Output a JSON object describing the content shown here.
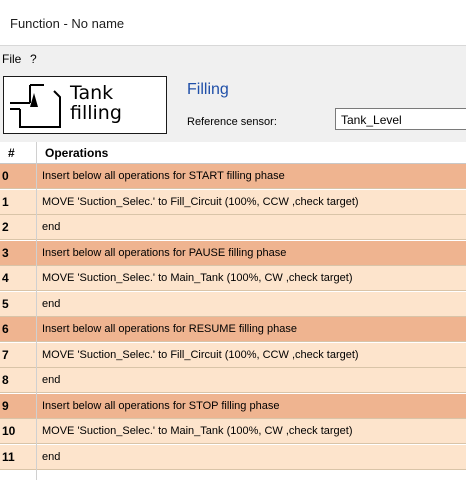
{
  "window": {
    "title": "Function - No name"
  },
  "menu": {
    "items": [
      "File",
      "?"
    ]
  },
  "header": {
    "logo_line1": "Tank",
    "logo_line2": "filling",
    "section_title": "Filling",
    "reference_label": "Reference sensor:",
    "reference_value": "Tank_Level"
  },
  "grid": {
    "columns": [
      "#",
      "Operations"
    ],
    "rows": [
      {
        "num": "0",
        "text": "Insert below all operations for START filling phase",
        "kind": "header"
      },
      {
        "num": "1",
        "text": "MOVE 'Suction_Selec.' to Fill_Circuit (100%, CCW ,check target)",
        "kind": "op"
      },
      {
        "num": "2",
        "text": "end",
        "kind": "op"
      },
      {
        "num": "3",
        "text": "Insert below all operations for PAUSE filling phase",
        "kind": "header"
      },
      {
        "num": "4",
        "text": "MOVE 'Suction_Selec.' to Main_Tank (100%, CW ,check target)",
        "kind": "op"
      },
      {
        "num": "5",
        "text": "end",
        "kind": "op"
      },
      {
        "num": "6",
        "text": "Insert below all operations for RESUME filling phase",
        "kind": "header"
      },
      {
        "num": "7",
        "text": "MOVE 'Suction_Selec.' to Fill_Circuit (100%, CCW ,check target)",
        "kind": "op"
      },
      {
        "num": "8",
        "text": "end",
        "kind": "op"
      },
      {
        "num": "9",
        "text": "Insert below all operations for STOP filling phase",
        "kind": "header"
      },
      {
        "num": "10",
        "text": "MOVE 'Suction_Selec.' to Main_Tank (100%, CW ,check target)",
        "kind": "op"
      },
      {
        "num": "11",
        "text": "end",
        "kind": "op"
      }
    ]
  },
  "colors": {
    "phase_row": "#efb490",
    "operation_row": "#fde4cc",
    "title_accent": "#1f4fa8"
  }
}
